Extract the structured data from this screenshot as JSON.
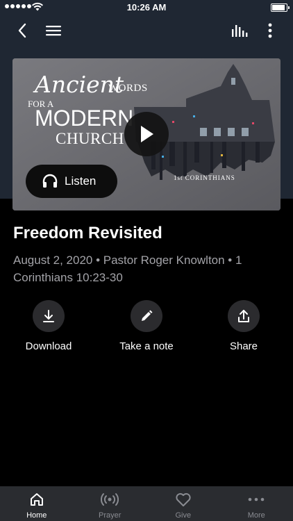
{
  "status_bar": {
    "time": "10:26 AM",
    "battery_level": 0.9
  },
  "nav": {
    "back_icon": "chevron-left-icon",
    "menu_icon": "hamburger-menu-icon",
    "audio_icon": "equalizer-icon",
    "more_icon": "vertical-dots-icon"
  },
  "hero": {
    "art_ancient": "Ancient",
    "art_words": "WORDS",
    "art_for_a": "FOR A",
    "art_modern": "MODERN",
    "art_church": "CHURCH",
    "art_book": "1st CORINTHIANS",
    "play_icon": "play-icon",
    "listen_label": "Listen",
    "listen_icon": "headphones-icon"
  },
  "sermon": {
    "title": "Freedom Revisited",
    "meta": "August 2, 2020 • Pastor Roger Knowlton • 1 Corinthians 10:23-30"
  },
  "actions": [
    {
      "label": "Download",
      "icon": "download-icon"
    },
    {
      "label": "Take a note",
      "icon": "pencil-icon"
    },
    {
      "label": "Share",
      "icon": "share-icon"
    }
  ],
  "tabs": [
    {
      "label": "Home",
      "icon": "home-icon",
      "active": true
    },
    {
      "label": "Prayer",
      "icon": "broadcast-icon",
      "active": false
    },
    {
      "label": "Give",
      "icon": "heart-icon",
      "active": false
    },
    {
      "label": "More",
      "icon": "more-horizontal-icon",
      "active": false
    }
  ],
  "colors": {
    "header_bg": "#1f2733",
    "page_bg": "#000000",
    "tab_bar_bg": "#2a2c30",
    "meta_text": "#a3a3a8"
  }
}
